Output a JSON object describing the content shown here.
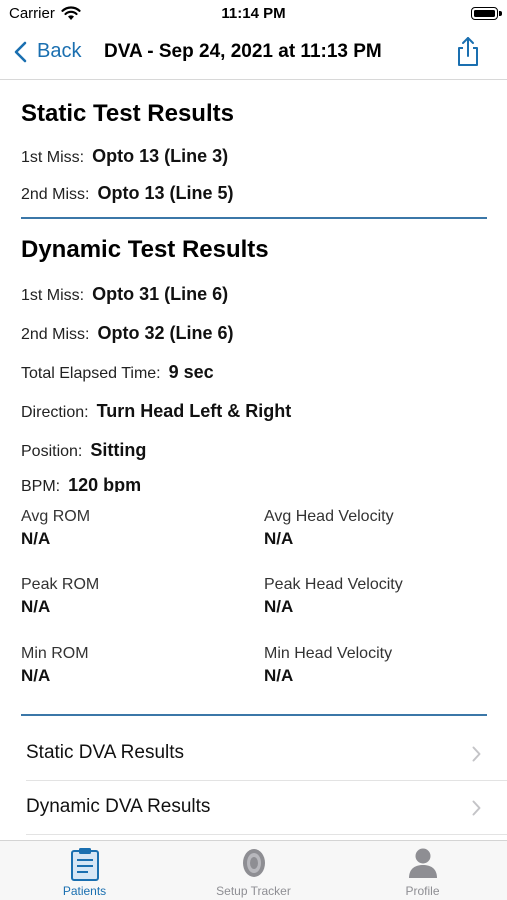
{
  "status_bar": {
    "carrier": "Carrier",
    "time": "11:14 PM"
  },
  "nav": {
    "back_label": "Back",
    "title": "DVA - Sep 24, 2021 at 11:13 PM"
  },
  "static_results": {
    "title": "Static Test Results",
    "rows": [
      {
        "label": "1st Miss:",
        "value": "Opto 13 (Line 3)"
      },
      {
        "label": "2nd Miss:",
        "value": "Opto 13 (Line 5)"
      }
    ]
  },
  "dynamic_results": {
    "title": "Dynamic Test Results",
    "rows": [
      {
        "label": "1st Miss:",
        "value": "Opto 31 (Line 6)"
      },
      {
        "label": "2nd Miss:",
        "value": "Opto 32 (Line 6)"
      },
      {
        "label": "Total Elapsed Time:",
        "value": "9 sec"
      },
      {
        "label": "Direction:",
        "value": "Turn Head Left & Right"
      },
      {
        "label": "Position:",
        "value": "Sitting"
      },
      {
        "label": "BPM:",
        "value": "120 bpm"
      }
    ],
    "metrics": [
      {
        "label": "Avg ROM",
        "value": "N/A"
      },
      {
        "label": "Avg Head Velocity",
        "value": "N/A"
      },
      {
        "label": "Peak ROM",
        "value": "N/A"
      },
      {
        "label": "Peak Head Velocity",
        "value": "N/A"
      },
      {
        "label": "Min ROM",
        "value": "N/A"
      },
      {
        "label": "Min Head Velocity",
        "value": "N/A"
      }
    ]
  },
  "links": [
    {
      "label": "Static DVA Results"
    },
    {
      "label": "Dynamic DVA Results"
    }
  ],
  "tabs": [
    {
      "label": "Patients",
      "icon": "clipboard-icon",
      "selected": true
    },
    {
      "label": "Setup Tracker",
      "icon": "tracker-icon",
      "selected": false
    },
    {
      "label": "Profile",
      "icon": "person-icon",
      "selected": false
    }
  ],
  "colors": {
    "accent": "#1a6fb0",
    "divider": "#3b77a8",
    "inactive": "#8e8e93"
  }
}
